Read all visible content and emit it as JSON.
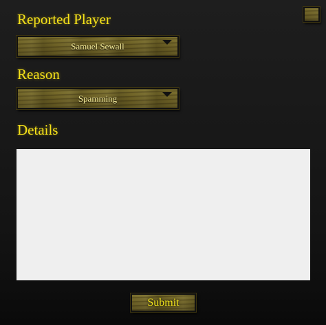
{
  "form": {
    "reported_player_label": "Reported Player",
    "reported_player_value": "Samuel Sewall",
    "reason_label": "Reason",
    "reason_value": "Spamming",
    "details_label": "Details",
    "details_value": "",
    "submit_label": "Submit"
  },
  "icons": {
    "close": "close-icon",
    "dropdown": "chevron-down-icon"
  },
  "colors": {
    "heading_text": "#f5e21a",
    "wood": "#6a5e24",
    "background": "#1b1b1b",
    "details_background": "#efefef"
  }
}
